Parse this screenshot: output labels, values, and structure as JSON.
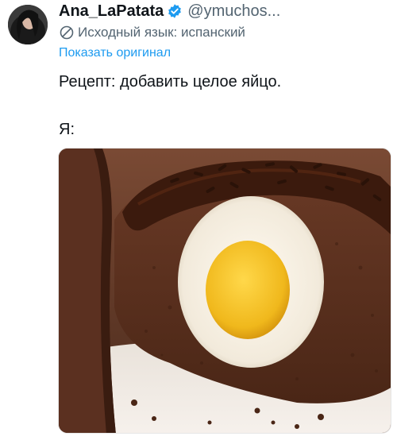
{
  "tweet": {
    "display_name": "Ana_LaPatata",
    "handle": "@ymuchos...",
    "translation_notice": "Исходный язык: испанский",
    "show_original": "Показать оригинал",
    "text_lines": [
      "Рецепт: добавить целое яйцо.",
      "Я:"
    ]
  },
  "icons": {
    "verified": "verified-badge-icon",
    "translate": "translate-icon"
  },
  "colors": {
    "link": "#1d9bf0",
    "secondary": "#536471",
    "verified": "#1d9bf0"
  }
}
